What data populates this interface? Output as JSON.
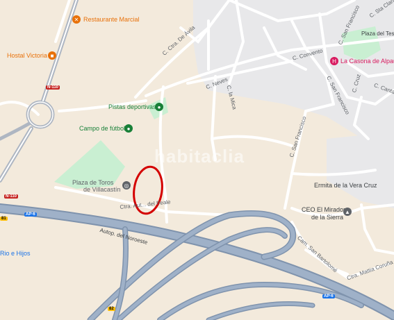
{
  "colors": {
    "land": "#f3eadc",
    "urban": "#e8e8ea",
    "green": "#c9efd2",
    "highway_fill": "#9fb1c8",
    "highway_edge": "#7f93ad",
    "street": "#ffffff",
    "poi_orange": "#e8710a",
    "poi_green": "#188038",
    "poi_gray": "#5f6368",
    "poi_pink": "#d81b60",
    "road_label_red": "#c5221f",
    "marker_red": "#d40000"
  },
  "poi": {
    "restaurante": {
      "name": "Restaurante Marcial",
      "icon": "fork-knife-icon"
    },
    "hostal": {
      "name": "Hostal Victoria",
      "icon": "bed-icon"
    },
    "pistas": {
      "name": "Pistas deportivas",
      "icon": "sports-icon"
    },
    "campo": {
      "name": "Campo de fútbol",
      "icon": "sports-icon"
    },
    "plaza_toros_1": "Plaza de Toros",
    "plaza_toros_2": "de Villacastín",
    "plaza_toros_icon": "landmark-icon",
    "casona": {
      "name": "La Casona de Alpau",
      "icon": "hotel-icon"
    },
    "ermita": "Ermita de la Vera Cruz",
    "ceo_1": "CEO El Mirador",
    "ceo_2": "de la Sierra",
    "ceo_icon": "school-icon",
    "rio": "Rio e Hijos",
    "plaza_del": "Plaza del Teso"
  },
  "streets": {
    "ctra_avila": "C. Ctra. De Ávila",
    "neves": "C. Neves",
    "convento": "C. Convento",
    "mica": "C. la Mica",
    "san_francisco_1": "C. San Francisco",
    "san_francisco_2": "C. San Francisco",
    "cruz": "C. Cruz",
    "sta_clara": "C. Sta Clara",
    "canta": "C. Canta",
    "autop": "Autop. del Noroeste",
    "ctra_peale": "Ctra. Aut... del Peale",
    "cam_san_bartolome": "Cam. San Bartolomé",
    "ctra_mattia": "Ctra. Mattia Coruña"
  },
  "shields": {
    "n110_top": "N-110",
    "n110_left": "N-110",
    "ap6_left": "AP-6",
    "ap6_right": "AP-6",
    "a81": "81",
    "a82": "82"
  },
  "watermark": "habitaclia",
  "annotation": {
    "shape": "red-ellipse-marker"
  }
}
